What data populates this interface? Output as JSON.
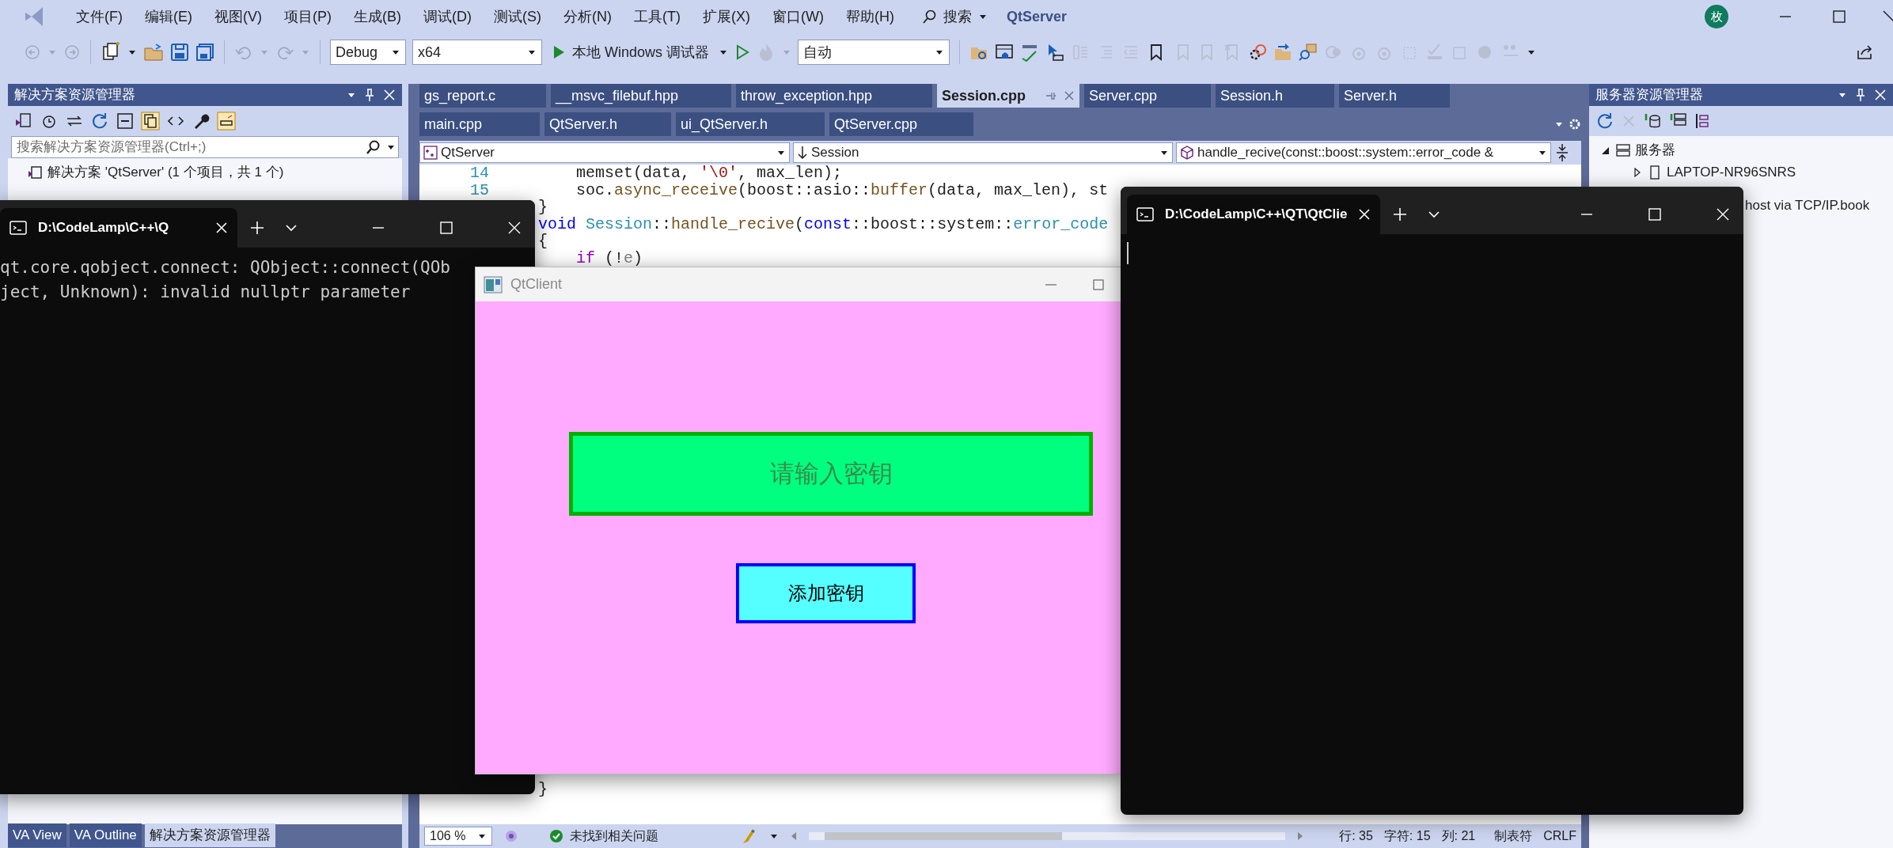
{
  "title_bar": {
    "menus": [
      "文件(F)",
      "编辑(E)",
      "视图(V)",
      "项目(P)",
      "生成(B)",
      "调试(D)",
      "测试(S)",
      "分析(N)",
      "工具(T)",
      "扩展(X)",
      "窗口(W)",
      "帮助(H)"
    ],
    "search": "搜索",
    "title": "QtServer",
    "avatar": "枚"
  },
  "toolbar": {
    "configuration": "Debug",
    "platform": "x64",
    "debugger": "本地 Windows 调试器",
    "mode": "自动"
  },
  "solution_explorer": {
    "title": "解决方案资源管理器",
    "search": {
      "placeholder": "搜索解决方案资源管理器(Ctrl+;)"
    },
    "tree": [
      {
        "label": "解决方案 'QtServer' (1 个项目，共 1 个)"
      }
    ]
  },
  "editor": {
    "tab_rows": [
      [
        {
          "label": "gs_report.c",
          "selected": false
        },
        {
          "label": "__msvc_filebuf.hpp",
          "selected": false
        },
        {
          "label": "throw_exception.hpp",
          "selected": false
        },
        {
          "label": "Session.cpp",
          "selected": true
        },
        {
          "label": "Server.cpp",
          "selected": false
        },
        {
          "label": "Session.h",
          "selected": false
        },
        {
          "label": "Server.h",
          "selected": false
        }
      ],
      [
        {
          "label": "main.cpp",
          "selected": false
        },
        {
          "label": "QtServer.h",
          "selected": false
        },
        {
          "label": "ui_QtServer.h",
          "selected": false
        },
        {
          "label": "QtServer.cpp",
          "selected": false
        }
      ]
    ],
    "nav": {
      "project": "QtServer",
      "scope": "Session",
      "member": "handle_recive(const::boost::system::error_code &"
    },
    "code_lines": [
      {
        "number": "14",
        "tokens": [
          {
            "text": "    memset(data, ",
            "kind": "plain"
          },
          {
            "text": "'\\0'",
            "kind": "string"
          },
          {
            "text": ", max_len);",
            "kind": "plain"
          }
        ]
      },
      {
        "number": "15",
        "tokens": [
          {
            "text": "    soc.",
            "kind": "plain"
          },
          {
            "text": "async_receive",
            "kind": "func"
          },
          {
            "text": "(boost::asio::",
            "kind": "plain"
          },
          {
            "text": "buffer",
            "kind": "func"
          },
          {
            "text": "(data, max_len), st",
            "kind": "plain"
          }
        ]
      },
      {
        "tokens": [
          {
            "text": "}",
            "kind": "plain"
          }
        ]
      },
      {
        "tokens": [
          {
            "text": "void",
            "kind": "keyword"
          },
          {
            "text": " Session",
            "kind": "type"
          },
          {
            "text": "::",
            "kind": "plain"
          },
          {
            "text": "handle_recive",
            "kind": "func"
          },
          {
            "text": "(",
            "kind": "plain"
          },
          {
            "text": "const",
            "kind": "keyword"
          },
          {
            "text": "::boost::system::",
            "kind": "plain"
          },
          {
            "text": "error_code",
            "kind": "type"
          }
        ]
      },
      {
        "tokens": [
          {
            "text": "{",
            "kind": "plain"
          }
        ]
      },
      {
        "tokens": [
          {
            "text": "    if",
            "kind": "control"
          },
          {
            "text": " (!",
            "kind": "plain"
          },
          {
            "text": "e",
            "kind": "param"
          },
          {
            "text": ")",
            "kind": "plain"
          }
        ]
      },
      {
        "tokens": [
          {
            "text": "}",
            "kind": "plain"
          }
        ]
      }
    ]
  },
  "server_explorer": {
    "title": "服务器资源管理器",
    "tree": [
      {
        "label": "服务器",
        "expanded": true,
        "children": [
          {
            "label": "LAPTOP-NR96SNRS",
            "expanded": false
          }
        ]
      }
    ],
    "partial_row": "host via TCP/IP.book"
  },
  "bottom_tabs": [
    {
      "label": "VA View",
      "selected": false
    },
    {
      "label": "VA Outline",
      "selected": false
    },
    {
      "label": "解决方案资源管理器",
      "selected": true
    }
  ],
  "status_bar": {
    "zoom": "106 %",
    "issues": "未找到相关问题",
    "line": "行: 35",
    "char": "字符: 15",
    "col": "列: 21",
    "indent": "制表符",
    "eol": "CRLF"
  },
  "terminals": [
    {
      "title": "D:\\CodeLamp\\C++\\Q",
      "lines": [
        "qt.core.qobject.connect: QObject::connect(QOb",
        "ject, Unknown): invalid nullptr parameter"
      ],
      "cursor": false
    },
    {
      "title": "D:\\CodeLamp\\C++\\QT\\QtClie",
      "cursor": true
    }
  ],
  "qt_client": {
    "title": "QtClient",
    "key_field": {
      "placeholder": "请输入密钥"
    },
    "add_button": "添加密钥"
  }
}
